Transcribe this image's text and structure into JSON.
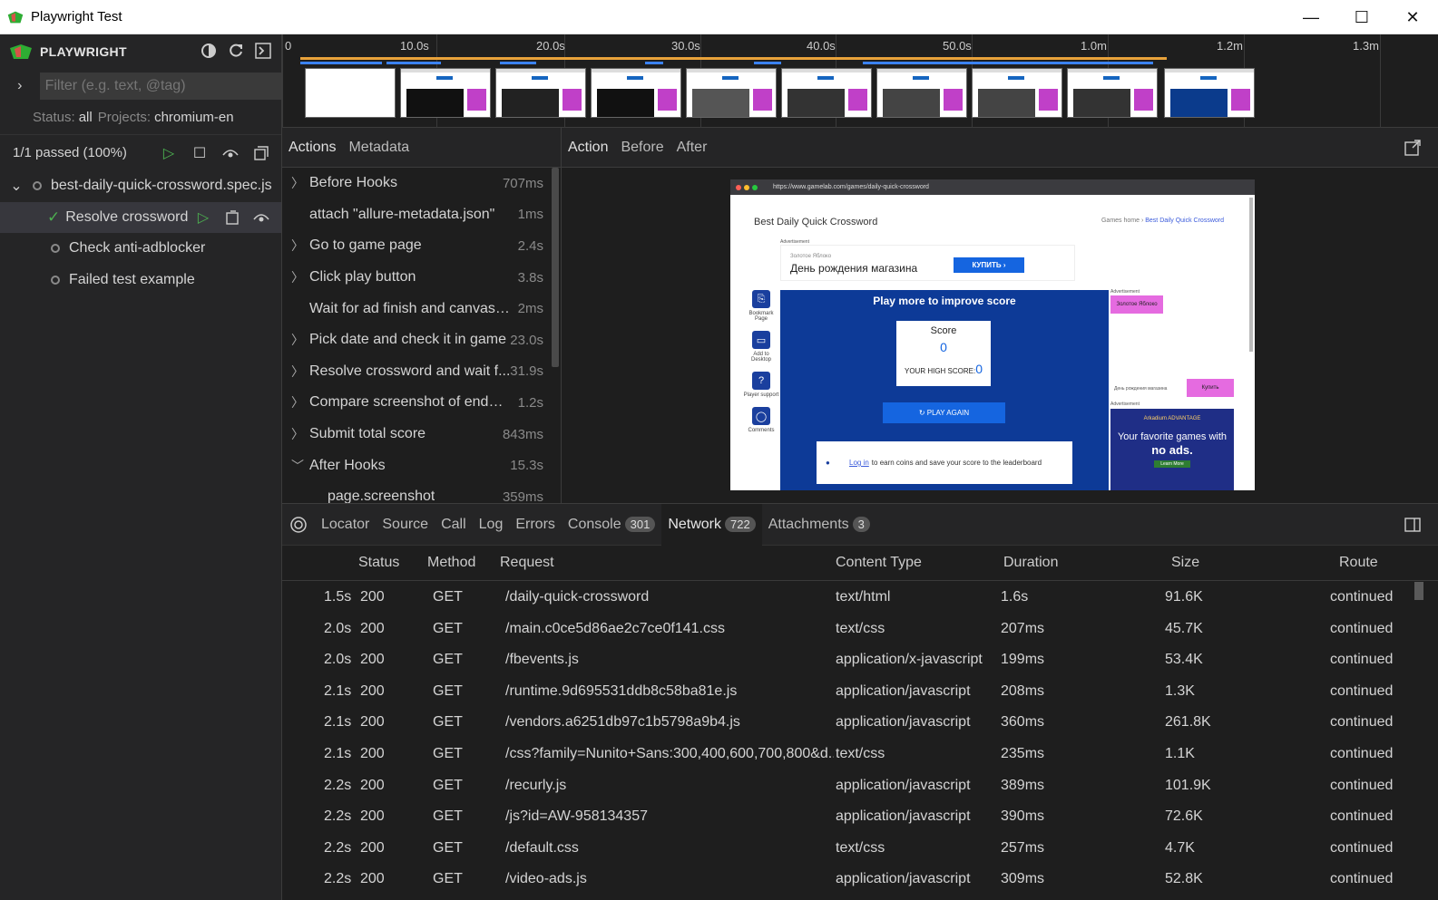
{
  "window": {
    "title": "Playwright Test",
    "minimize": "—",
    "maximize": "☐",
    "close": "✕"
  },
  "sidebar": {
    "brand": "PLAYWRIGHT",
    "filter_placeholder": "Filter (e.g. text, @tag)",
    "status_label": "Status:",
    "status_value": "all",
    "projects_label": "Projects:",
    "projects_value": "chromium-en",
    "passed_summary": "1/1 passed (100%)",
    "file": "best-daily-quick-crossword.spec.js",
    "tests": [
      {
        "label": "Resolve crossword",
        "state": "passed"
      },
      {
        "label": "Check anti-adblocker",
        "state": "none"
      },
      {
        "label": "Failed test example",
        "state": "none"
      }
    ]
  },
  "timeline": {
    "ticks": [
      "0",
      "10.0s",
      "20.0s",
      "30.0s",
      "40.0s",
      "50.0s",
      "1.0m",
      "1.2m",
      "1.3m"
    ]
  },
  "actions_panel": {
    "tabs": [
      "Actions",
      "Metadata"
    ],
    "items": [
      {
        "label": "Before Hooks",
        "duration": "707ms",
        "expandable": true,
        "expanded": false
      },
      {
        "label": "attach \"allure-metadata.json\"",
        "duration": "1ms",
        "expandable": false
      },
      {
        "label": "Go to game page",
        "duration": "2.4s",
        "expandable": true,
        "expanded": false
      },
      {
        "label": "Click play button",
        "duration": "3.8s",
        "expandable": true,
        "expanded": false
      },
      {
        "label": "Wait for ad finish and canvas ...",
        "duration": "2ms",
        "expandable": false
      },
      {
        "label": "Pick date and check it in game",
        "duration": "23.0s",
        "expandable": true,
        "expanded": false
      },
      {
        "label": "Resolve crossword and wait f...",
        "duration": "31.9s",
        "expandable": true,
        "expanded": false
      },
      {
        "label": "Compare screenshot of endga...",
        "duration": "1.2s",
        "expandable": true,
        "expanded": false
      },
      {
        "label": "Submit total score",
        "duration": "843ms",
        "expandable": true,
        "expanded": false
      },
      {
        "label": "After Hooks",
        "duration": "15.3s",
        "expandable": true,
        "expanded": true
      },
      {
        "label": "page.screenshot",
        "duration": "359ms",
        "expandable": false,
        "indent": true
      }
    ]
  },
  "preview_panel": {
    "tabs": [
      "Action",
      "Before",
      "After"
    ],
    "snapshot": {
      "url": "https://www.gamelab.com/games/daily-quick-crossword",
      "site_title": "Best Daily Quick Crossword",
      "crumb_home": "Games home",
      "crumb_current": "Best Daily Quick Crossword",
      "ad_label": "Advertisement",
      "ad_small": "Золотое Яблоко",
      "ad_text": "День рождения магазина",
      "ad_button": "КУПИТЬ",
      "tools": [
        "Bookmark Page",
        "Add to Desktop",
        "Player support",
        "Comments"
      ],
      "game_title": "Play more to improve score",
      "score_label": "Score",
      "score_value": "0",
      "high_score_label": "YOUR HIGH SCORE:",
      "high_score_value": "0",
      "play_again": "PLAY AGAIN",
      "login_link": "Log in",
      "login_text": "to earn coins and save your score to the leaderboard",
      "side_ad_label": "Advertisement",
      "side_ad_small": "Золотое Яблоко",
      "side_ad_text": "День рождения магазина",
      "side_ad_button": "Купить",
      "side_ad2_label": "Advertisement",
      "arkadium_brand": "Arkadium ADVANTAGE",
      "arkadium_text": "Your favorite games with",
      "arkadium_bold": "no ads.",
      "arkadium_cta": "Learn More"
    }
  },
  "bottom_panel": {
    "tabs": [
      {
        "label": "Locator"
      },
      {
        "label": "Source"
      },
      {
        "label": "Call"
      },
      {
        "label": "Log"
      },
      {
        "label": "Errors"
      },
      {
        "label": "Console",
        "badge": "301"
      },
      {
        "label": "Network",
        "badge": "722"
      },
      {
        "label": "Attachments",
        "badge": "3"
      }
    ],
    "columns": [
      "Status",
      "Method",
      "Request",
      "Content Type",
      "Duration",
      "Size",
      "Route"
    ],
    "rows": [
      {
        "time": "1.5s",
        "status": "200",
        "method": "GET",
        "request": "/daily-quick-crossword",
        "type": "text/html",
        "duration": "1.6s",
        "size": "91.6K",
        "route": "continued"
      },
      {
        "time": "2.0s",
        "status": "200",
        "method": "GET",
        "request": "/main.c0ce5d86ae2c7ce0f141.css",
        "type": "text/css",
        "duration": "207ms",
        "size": "45.7K",
        "route": "continued"
      },
      {
        "time": "2.0s",
        "status": "200",
        "method": "GET",
        "request": "/fbevents.js",
        "type": "application/x-javascript",
        "duration": "199ms",
        "size": "53.4K",
        "route": "continued"
      },
      {
        "time": "2.1s",
        "status": "200",
        "method": "GET",
        "request": "/runtime.9d695531ddb8c58ba81e.js",
        "type": "application/javascript",
        "duration": "208ms",
        "size": "1.3K",
        "route": "continued"
      },
      {
        "time": "2.1s",
        "status": "200",
        "method": "GET",
        "request": "/vendors.a6251db97c1b5798a9b4.js",
        "type": "application/javascript",
        "duration": "360ms",
        "size": "261.8K",
        "route": "continued"
      },
      {
        "time": "2.1s",
        "status": "200",
        "method": "GET",
        "request": "/css?family=Nunito+Sans:300,400,600,700,800&d...",
        "type": "text/css",
        "duration": "235ms",
        "size": "1.1K",
        "route": "continued"
      },
      {
        "time": "2.2s",
        "status": "200",
        "method": "GET",
        "request": "/recurly.js",
        "type": "application/javascript",
        "duration": "389ms",
        "size": "101.9K",
        "route": "continued"
      },
      {
        "time": "2.2s",
        "status": "200",
        "method": "GET",
        "request": "/js?id=AW-958134357",
        "type": "application/javascript",
        "duration": "390ms",
        "size": "72.6K",
        "route": "continued"
      },
      {
        "time": "2.2s",
        "status": "200",
        "method": "GET",
        "request": "/default.css",
        "type": "text/css",
        "duration": "257ms",
        "size": "4.7K",
        "route": "continued"
      },
      {
        "time": "2.2s",
        "status": "200",
        "method": "GET",
        "request": "/video-ads.js",
        "type": "application/javascript",
        "duration": "309ms",
        "size": "52.8K",
        "route": "continued"
      }
    ]
  },
  "colors": {
    "accent_green": "#4caf50",
    "background": "#1e1e1e",
    "panel": "#252526"
  }
}
